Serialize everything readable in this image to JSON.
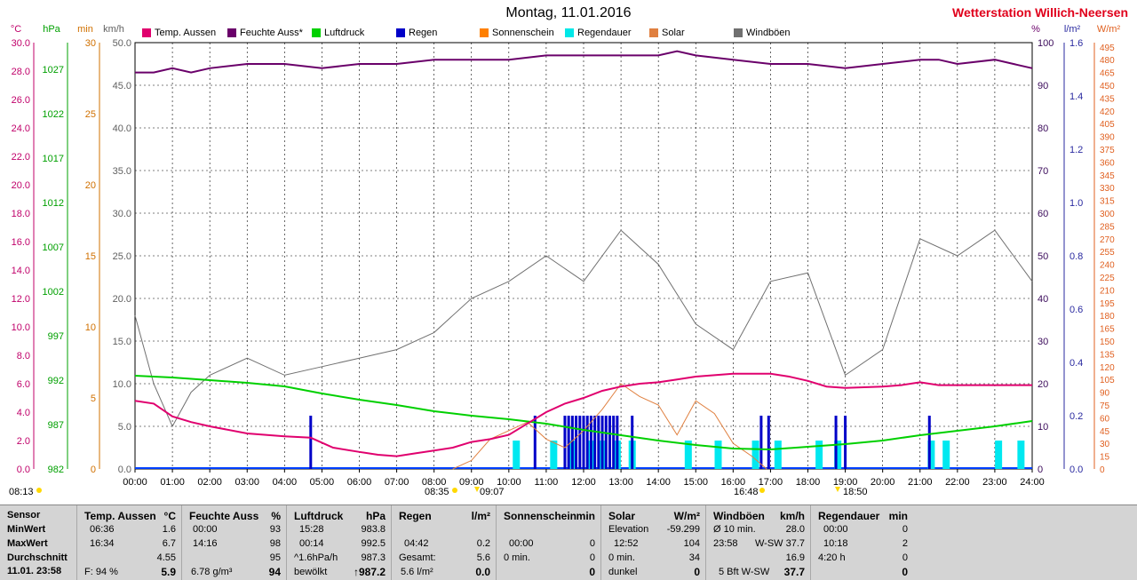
{
  "header": {
    "title": "Montag, 11.01.2016",
    "station": "Wetterstation Willich-Neersen"
  },
  "legend": [
    {
      "label": "Temp. Aussen",
      "color": "#e0006e"
    },
    {
      "label": "Feuchte Auss*",
      "color": "#6a006a"
    },
    {
      "label": "Luftdruck",
      "color": "#00d000"
    },
    {
      "label": "Regen",
      "color": "#0000c8"
    },
    {
      "label": "Sonnenschein",
      "color": "#ff8000"
    },
    {
      "label": "Regendauer",
      "color": "#00e8e8"
    },
    {
      "label": "Solar",
      "color": "#e08040"
    },
    {
      "label": "Windböen",
      "color": "#707070"
    }
  ],
  "axes": {
    "temp_unit": "°C",
    "press_unit": "hPa",
    "min_unit": "min",
    "wind_unit": "km/h",
    "hum_unit": "%",
    "rain_unit": "l/m²",
    "solar_unit": "W/m²",
    "temp_ticks": [
      "30.0",
      "28.0",
      "26.0",
      "24.0",
      "22.0",
      "20.0",
      "18.0",
      "16.0",
      "14.0",
      "12.0",
      "10.0",
      "8.0",
      "6.0",
      "4.0",
      "2.0",
      "0.0"
    ],
    "press_ticks": [
      "1027",
      "1022",
      "1017",
      "1012",
      "1007",
      "1002",
      "997",
      "992",
      "987",
      "982"
    ],
    "min_ticks": [
      "30",
      "25",
      "20",
      "15",
      "10",
      "5",
      "0"
    ],
    "wind_ticks": [
      "50.0",
      "45.0",
      "40.0",
      "35.0",
      "30.0",
      "25.0",
      "20.0",
      "15.0",
      "10.0",
      "5.0",
      "0.0"
    ],
    "hum_ticks": [
      "100",
      "90",
      "80",
      "70",
      "60",
      "50",
      "40",
      "30",
      "20",
      "10",
      "0"
    ],
    "rain_ticks": [
      "1.6",
      "1.4",
      "1.2",
      "1.0",
      "0.8",
      "0.6",
      "0.4",
      "0.2",
      "0.0"
    ],
    "solar_ticks": [
      "495",
      "480",
      "465",
      "450",
      "435",
      "420",
      "405",
      "390",
      "375",
      "360",
      "345",
      "330",
      "315",
      "300",
      "285",
      "270",
      "255",
      "240",
      "225",
      "210",
      "195",
      "180",
      "165",
      "150",
      "135",
      "120",
      "105",
      "90",
      "75",
      "60",
      "45",
      "30",
      "15",
      "0"
    ],
    "x_ticks": [
      "00:00",
      "01:00",
      "02:00",
      "03:00",
      "04:00",
      "05:00",
      "06:00",
      "07:00",
      "08:00",
      "09:00",
      "10:00",
      "11:00",
      "12:00",
      "13:00",
      "14:00",
      "15:00",
      "16:00",
      "17:00",
      "18:00",
      "19:00",
      "20:00",
      "21:00",
      "22:00",
      "23:00",
      "24:00"
    ]
  },
  "sun_times": {
    "sunrise": "08:35",
    "noon": "09:07",
    "sunset": "16:48",
    "set2": "18:50",
    "daylen": "08:13"
  },
  "chart_data": {
    "type": "line",
    "x_unit": "hour",
    "temperature": {
      "name": "Temp. Aussen",
      "x": [
        0,
        0.5,
        1,
        1.5,
        2,
        3,
        4,
        4.7,
        5.3,
        6,
        6.5,
        7,
        7.5,
        8,
        8.5,
        9,
        9.5,
        10,
        10.5,
        11,
        11.5,
        12,
        12.5,
        13,
        13.5,
        14,
        14.5,
        15,
        15.5,
        16,
        16.5,
        17,
        17.5,
        18,
        18.5,
        19,
        20,
        20.5,
        21,
        21.5,
        22,
        23,
        24
      ],
      "y": [
        4.8,
        4.6,
        3.7,
        3.3,
        3.0,
        2.5,
        2.3,
        2.2,
        1.5,
        1.2,
        1.0,
        0.9,
        1.1,
        1.3,
        1.5,
        1.9,
        2.1,
        2.4,
        3.2,
        4.0,
        4.6,
        5.0,
        5.5,
        5.8,
        6.0,
        6.1,
        6.3,
        6.5,
        6.6,
        6.7,
        6.7,
        6.7,
        6.5,
        6.2,
        5.8,
        5.7,
        5.8,
        5.9,
        6.1,
        5.9,
        5.9,
        5.9,
        5.9
      ]
    },
    "humidity": {
      "name": "Feuchte Auss*",
      "x": [
        0,
        0.5,
        1,
        1.5,
        2,
        3,
        4,
        5,
        6,
        7,
        8,
        9,
        10,
        11,
        12,
        13,
        14,
        14.5,
        15,
        16,
        17,
        18,
        19,
        20,
        21,
        21.5,
        22,
        23,
        23.5,
        24
      ],
      "y": [
        93,
        93,
        94,
        93,
        94,
        95,
        95,
        94,
        95,
        95,
        96,
        96,
        96,
        97,
        97,
        97,
        97,
        98,
        97,
        96,
        95,
        95,
        94,
        95,
        96,
        96,
        95,
        96,
        95,
        94
      ]
    },
    "pressure": {
      "name": "Luftdruck",
      "x": [
        0,
        1,
        2,
        3,
        4,
        5,
        6,
        7,
        8,
        9,
        10,
        11,
        12,
        13,
        14,
        15,
        16,
        17,
        18,
        19,
        20,
        21,
        22,
        23,
        24
      ],
      "y": [
        992.5,
        992.3,
        992.0,
        991.7,
        991.3,
        990.5,
        989.8,
        989.2,
        988.5,
        988.0,
        987.6,
        987.1,
        986.4,
        985.8,
        985.2,
        984.7,
        984.3,
        984.2,
        984.5,
        984.8,
        985.2,
        985.8,
        986.3,
        986.8,
        987.4
      ]
    },
    "wind_gusts": {
      "name": "Windböen",
      "x": [
        0,
        0.5,
        1,
        1.5,
        2,
        3,
        4,
        5,
        6,
        7,
        8,
        9,
        10,
        11,
        12,
        13,
        14,
        15,
        16,
        17,
        18,
        19,
        20,
        21,
        22,
        23,
        24
      ],
      "y": [
        18,
        10,
        5,
        9,
        11,
        13,
        11,
        12,
        13,
        14,
        16,
        20,
        22,
        25,
        22,
        28,
        24,
        17,
        14,
        22,
        23,
        11,
        14,
        27,
        25,
        28,
        22
      ]
    },
    "solar": {
      "name": "Solar",
      "x": [
        8.5,
        9,
        9.5,
        10,
        10.5,
        11,
        11.5,
        12,
        12.5,
        13,
        13.5,
        14,
        14.5,
        15,
        15.5,
        16,
        16.5,
        16.9
      ],
      "y": [
        0,
        10,
        35,
        45,
        55,
        35,
        25,
        45,
        70,
        100,
        85,
        75,
        40,
        80,
        65,
        30,
        15,
        0
      ]
    },
    "rain_minutes": {
      "name": "Regendauer",
      "x": [
        10.2,
        11.2,
        11.7,
        12.2,
        12.5,
        12.9,
        13.3,
        14.8,
        15.6,
        16.6,
        17.2,
        18.3,
        18.8,
        21.3,
        21.7,
        23.1,
        23.7
      ],
      "y": [
        2,
        2,
        2,
        2,
        2,
        2,
        2,
        2,
        2,
        2,
        2,
        2,
        2,
        2,
        2,
        2,
        2
      ]
    },
    "rain": {
      "name": "Regen",
      "x": [
        4.7,
        10.7,
        11.5,
        11.6,
        11.7,
        11.8,
        11.9,
        12.0,
        12.1,
        12.2,
        12.3,
        12.4,
        12.5,
        12.6,
        12.7,
        12.8,
        12.9,
        13.3,
        16.75,
        16.95,
        18.75,
        19.0,
        21.25
      ],
      "y": [
        0.2,
        0.2,
        0.2,
        0.2,
        0.2,
        0.2,
        0.2,
        0.2,
        0.2,
        0.2,
        0.2,
        0.2,
        0.2,
        0.2,
        0.2,
        0.2,
        0.2,
        0.2,
        0.2,
        0.2,
        0.2,
        0.2,
        0.2
      ]
    },
    "ranges": {
      "temp": [
        0,
        30
      ],
      "pressure": [
        982,
        1030
      ],
      "minutes": [
        0,
        30
      ],
      "wind": [
        0,
        50
      ],
      "humidity": [
        0,
        100
      ],
      "rain": [
        0,
        1.6
      ],
      "solar": [
        0,
        500
      ],
      "hours": [
        0,
        24
      ]
    },
    "grid": true
  },
  "stats": {
    "labels": {
      "sensor": "Sensor",
      "min": "MinWert",
      "max": "MaxWert",
      "avg": "Durchschnitt",
      "now": "11.01. 23:58"
    },
    "temp": {
      "title": "Temp. Aussen",
      "unit": "°C",
      "min_t": "06:36",
      "min_v": "1.6",
      "max_t": "16:34",
      "max_v": "6.7",
      "avg": "4.55",
      "now_l": "F: 94 %",
      "now_v": "5.9"
    },
    "hum": {
      "title": "Feuchte Auss",
      "unit": "%",
      "min_t": "00:00",
      "min_v": "93",
      "max_t": "14:16",
      "max_v": "98",
      "avg": "95",
      "now_l": "6.78 g/m³",
      "now_v": "94"
    },
    "press": {
      "title": "Luftdruck",
      "unit": "hPa",
      "min_t": "15:28",
      "min_v": "983.8",
      "max_t": "00:14",
      "max_v": "992.5",
      "avg_l": "^1.6hPa/h",
      "avg": "987.3",
      "now_l": "bewölkt",
      "now_v": "↑987.2"
    },
    "rain": {
      "title": "Regen",
      "unit": "l/m²",
      "max_t": "04:42",
      "max_v": "0.2",
      "avg_l": "Gesamt:",
      "avg": "5.6",
      "now_l": "5.6 l/m²",
      "now_v": "0.0"
    },
    "sun": {
      "title": "Sonnenschein",
      "unit": "min",
      "max_t": "00:00",
      "max_v": "0",
      "avg_l": "0 min.",
      "avg": "0",
      "now_v": "0"
    },
    "solar": {
      "title": "Solar",
      "unit": "W/m²",
      "min_t": "Elevation",
      "min_v": "-59.299",
      "max_t": "12:52",
      "max_v": "104",
      "avg_l": "0 min.",
      "avg": "34",
      "now_l": "dunkel",
      "now_v": "0"
    },
    "wind": {
      "title": "Windböen",
      "unit": "km/h",
      "min_t": "Ø 10 min.",
      "min_v": "28.0",
      "max_t": "23:58",
      "max_v": "W-SW 37.7",
      "avg": "16.9",
      "now_l": "5 Bft W-SW",
      "now_v": "37.7"
    },
    "rdur": {
      "title": "Regendauer",
      "unit": "min",
      "min_t": "00:00",
      "min_v": "0",
      "max_t": "10:18",
      "max_v": "2",
      "avg_l": "4:20 h",
      "avg": "0",
      "now_v": "0"
    }
  }
}
